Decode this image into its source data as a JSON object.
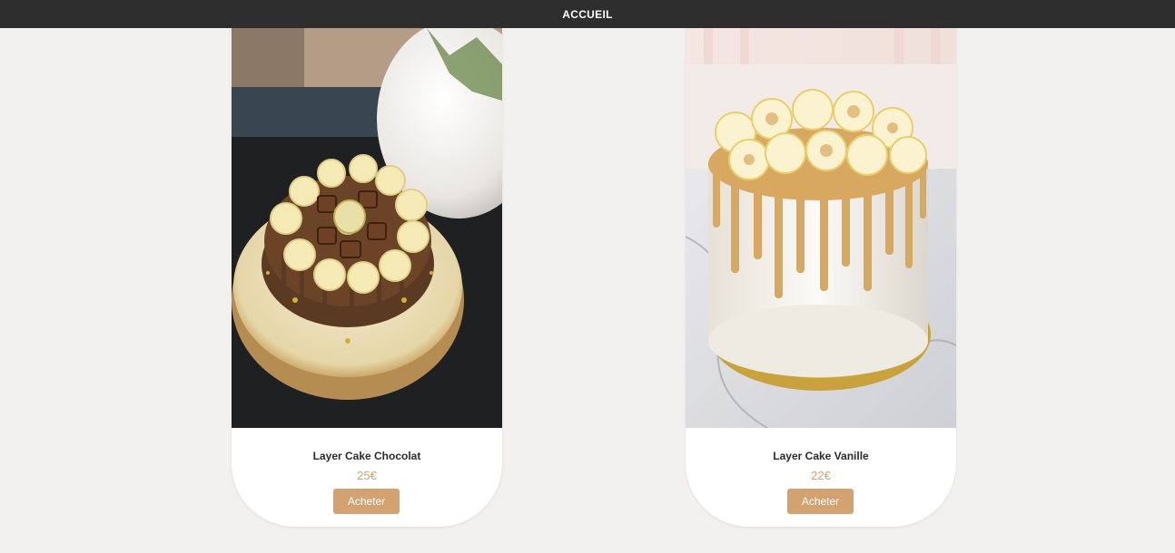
{
  "nav": {
    "home_label": "ACCUEIL"
  },
  "colors": {
    "topbar": "#2e2e2e",
    "background": "#f2f1ef",
    "accent": "#d2a271"
  },
  "products": [
    {
      "title": "Layer Cake Chocolat",
      "price": "25€",
      "button_label": "Acheter",
      "image": "chocolate-layer-cake-photo"
    },
    {
      "title": "Layer Cake Vanille",
      "price": "22€",
      "button_label": "Acheter",
      "image": "vanilla-caramel-drip-cake-photo"
    }
  ]
}
